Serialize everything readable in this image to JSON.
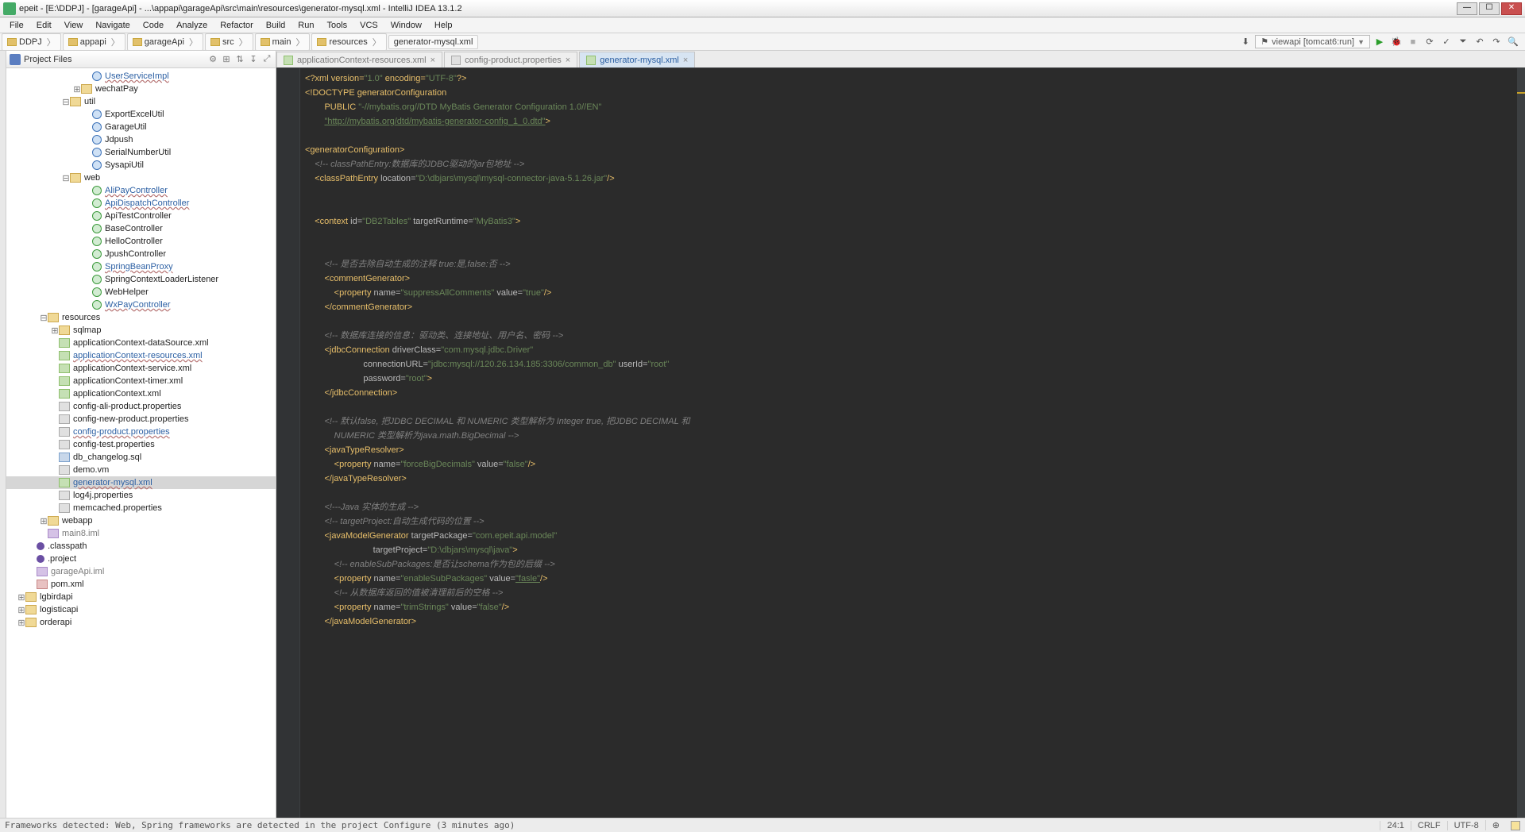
{
  "window": {
    "title": "epeit - [E:\\DDPJ] - [garageApi] - ...\\appapi\\garageApi\\src\\main\\resources\\generator-mysql.xml - IntelliJ IDEA 13.1.2",
    "min": "—",
    "max": "☐",
    "close": "✕"
  },
  "menu": {
    "items": [
      "File",
      "Edit",
      "View",
      "Navigate",
      "Code",
      "Analyze",
      "Refactor",
      "Build",
      "Run",
      "Tools",
      "VCS",
      "Window",
      "Help"
    ]
  },
  "breadcrumb": {
    "items": [
      "DDPJ",
      "appapi",
      "garageApi",
      "src",
      "main",
      "resources",
      "generator-mysql.xml"
    ]
  },
  "run_config": "viewapi [tomcat6:run]",
  "proj_header": "Project Files",
  "proj_tools": [
    "⚙",
    "⊞",
    "⇅",
    "↧",
    "⤢"
  ],
  "tree": [
    {
      "d": 7,
      "t": "C",
      "lbl": "UserServiceImpl",
      "cls": "linkish",
      "icon": "cls"
    },
    {
      "d": 6,
      "t": "+",
      "lbl": "wechatPay",
      "icon": "pkg"
    },
    {
      "d": 5,
      "t": "-",
      "lbl": "util",
      "icon": "pkg"
    },
    {
      "d": 7,
      "t": "C",
      "lbl": "ExportExcelUtil",
      "icon": "cls"
    },
    {
      "d": 7,
      "t": "C",
      "lbl": "GarageUtil",
      "icon": "cls"
    },
    {
      "d": 7,
      "t": "C",
      "lbl": "Jdpush",
      "icon": "cls"
    },
    {
      "d": 7,
      "t": "C",
      "lbl": "SerialNumberUtil",
      "icon": "cls"
    },
    {
      "d": 7,
      "t": "C",
      "lbl": "SysapiUtil",
      "icon": "cls"
    },
    {
      "d": 5,
      "t": "-",
      "lbl": "web",
      "icon": "pkg"
    },
    {
      "d": 7,
      "t": "C",
      "lbl": "AliPayController",
      "cls": "linkish",
      "icon": "cls green"
    },
    {
      "d": 7,
      "t": "C",
      "lbl": "ApiDispatchController",
      "cls": "linkish",
      "icon": "cls green"
    },
    {
      "d": 7,
      "t": "C",
      "lbl": "ApiTestController",
      "icon": "cls green"
    },
    {
      "d": 7,
      "t": "C",
      "lbl": "BaseController",
      "icon": "cls green"
    },
    {
      "d": 7,
      "t": "C",
      "lbl": "HelloController",
      "icon": "cls green"
    },
    {
      "d": 7,
      "t": "C",
      "lbl": "JpushController",
      "icon": "cls green"
    },
    {
      "d": 7,
      "t": "C",
      "lbl": "SpringBeanProxy",
      "cls": "linkish",
      "icon": "cls green"
    },
    {
      "d": 7,
      "t": "C",
      "lbl": "SpringContextLoaderListener",
      "icon": "cls green"
    },
    {
      "d": 7,
      "t": "C",
      "lbl": "WebHelper",
      "icon": "cls green"
    },
    {
      "d": 7,
      "t": "C",
      "lbl": "WxPayController",
      "cls": "linkish",
      "icon": "cls green"
    },
    {
      "d": 3,
      "t": "-",
      "lbl": "resources",
      "icon": "folder"
    },
    {
      "d": 4,
      "t": "+",
      "lbl": "sqlmap",
      "icon": "folder"
    },
    {
      "d": 4,
      "t": "",
      "lbl": "applicationContext-dataSource.xml",
      "icon": "xml"
    },
    {
      "d": 4,
      "t": "",
      "lbl": "applicationContext-resources.xml",
      "cls": "linkish",
      "icon": "xml"
    },
    {
      "d": 4,
      "t": "",
      "lbl": "applicationContext-service.xml",
      "icon": "xml"
    },
    {
      "d": 4,
      "t": "",
      "lbl": "applicationContext-timer.xml",
      "icon": "xml"
    },
    {
      "d": 4,
      "t": "",
      "lbl": "applicationContext.xml",
      "icon": "xml"
    },
    {
      "d": 4,
      "t": "",
      "lbl": "config-ali-product.properties",
      "icon": "prop"
    },
    {
      "d": 4,
      "t": "",
      "lbl": "config-new-product.properties",
      "icon": "prop"
    },
    {
      "d": 4,
      "t": "",
      "lbl": "config-product.properties",
      "cls": "linkish",
      "icon": "prop"
    },
    {
      "d": 4,
      "t": "",
      "lbl": "config-test.properties",
      "icon": "prop"
    },
    {
      "d": 4,
      "t": "",
      "lbl": "db_changelog.sql",
      "icon": "sql"
    },
    {
      "d": 4,
      "t": "",
      "lbl": "demo.vm",
      "icon": "prop"
    },
    {
      "d": 4,
      "t": "",
      "lbl": "generator-mysql.xml",
      "cls": "linkish",
      "sel": true,
      "icon": "xml"
    },
    {
      "d": 4,
      "t": "",
      "lbl": "log4j.properties",
      "icon": "prop"
    },
    {
      "d": 4,
      "t": "",
      "lbl": "memcached.properties",
      "icon": "prop"
    },
    {
      "d": 3,
      "t": "+",
      "lbl": "webapp",
      "icon": "folder"
    },
    {
      "d": 3,
      "t": "",
      "lbl": "main8.iml",
      "cls": "faded",
      "icon": "iml"
    },
    {
      "d": 2,
      "t": "",
      "lbl": ".classpath",
      "icon": "dot"
    },
    {
      "d": 2,
      "t": "",
      "lbl": ".project",
      "icon": "dot"
    },
    {
      "d": 2,
      "t": "",
      "lbl": "garageApi.iml",
      "cls": "faded",
      "icon": "iml"
    },
    {
      "d": 2,
      "t": "",
      "lbl": "pom.xml",
      "icon": "mvn"
    },
    {
      "d": 1,
      "t": "+",
      "lbl": "lgbirdapi",
      "icon": "folder"
    },
    {
      "d": 1,
      "t": "+",
      "lbl": "logisticapi",
      "icon": "folder"
    },
    {
      "d": 1,
      "t": "+",
      "lbl": "orderapi",
      "icon": "folder"
    }
  ],
  "tabs": [
    {
      "label": "applicationContext-resources.xml",
      "type": "xml",
      "active": false
    },
    {
      "label": "config-product.properties",
      "type": "prop",
      "active": false
    },
    {
      "label": "generator-mysql.xml",
      "type": "xml",
      "active": true
    }
  ],
  "code": {
    "l01a": "<?xml version=",
    "l01b": "\"1.0\"",
    "l01c": " encoding=",
    "l01d": "\"UTF-8\"",
    "l01e": "?>",
    "l02": "<!DOCTYPE generatorConfiguration",
    "l03a": "        PUBLIC ",
    "l03b": "\"-//mybatis.org//DTD MyBatis Generator Configuration 1.0//EN\"",
    "l04a": "        ",
    "l04b": "\"http://mybatis.org/dtd/mybatis-generator-config_1_0.dtd\"",
    "l04c": ">",
    "l06a": "<generatorConfiguration>",
    "l07": "    <!-- classPathEntry:数据库的JDBC驱动的jar包地址 -->",
    "l08a": "    <classPathEntry ",
    "l08b": "location=",
    "l08c": "\"D:\\dbjars\\mysql\\mysql-connector-java-5.1.26.jar\"",
    "l08d": "/>",
    "l11a": "    <context ",
    "l11b": "id=",
    "l11c": "\"DB2Tables\"",
    "l11d": " targetRuntime=",
    "l11e": "\"MyBatis3\"",
    "l11f": ">",
    "l14": "        <!-- 是否去除自动生成的注释 true:是,false:否 -->",
    "l15": "        <commentGenerator>",
    "l16a": "            <property ",
    "l16b": "name=",
    "l16c": "\"suppressAllComments\"",
    "l16d": " value=",
    "l16e": "\"true\"",
    "l16f": "/>",
    "l17": "        </commentGenerator>",
    "l19": "        <!-- 数据库连接的信息：驱动类、连接地址、用户名、密码 -->",
    "l20a": "        <jdbcConnection ",
    "l20b": "driverClass=",
    "l20c": "\"com.mysql.jdbc.Driver\"",
    "l21a": "                        connectionURL=",
    "l21b": "\"jdbc:mysql://120.26.134.185:3306/common_db\"",
    "l21c": " userId=",
    "l21d": "\"root\"",
    "l22a": "                        password=",
    "l22b": "\"root\"",
    "l22c": ">",
    "l23": "        </jdbcConnection>",
    "l25": "        <!-- 默认false, 把JDBC DECIMAL 和 NUMERIC 类型解析为 Integer true, 把JDBC DECIMAL 和",
    "l26": "            NUMERIC 类型解析为java.math.BigDecimal -->",
    "l27": "        <javaTypeResolver>",
    "l28a": "            <property ",
    "l28b": "name=",
    "l28c": "\"forceBigDecimals\"",
    "l28d": " value=",
    "l28e": "\"false\"",
    "l28f": "/>",
    "l29": "        </javaTypeResolver>",
    "l31": "        <!---Java 实体的生成 -->",
    "l32": "        <!-- targetProject:自动生成代码的位置 -->",
    "l33a": "        <javaModelGenerator ",
    "l33b": "targetPackage=",
    "l33c": "\"com.epeit.api.model\"",
    "l34a": "                            targetProject=",
    "l34b": "\"D:\\dbjars\\mysql\\java\"",
    "l34c": ">",
    "l35": "            <!-- enableSubPackages:是否让schema作为包的后缀 -->",
    "l36a": "            <property ",
    "l36b": "name=",
    "l36c": "\"enableSubPackages\"",
    "l36d": " value=",
    "l36e": "\"fasle\"",
    "l36f": "/>",
    "l37": "            <!-- 从数据库返回的值被清理前后的空格 -->",
    "l38a": "            <property ",
    "l38b": "name=",
    "l38c": "\"trimStrings\"",
    "l38d": " value=",
    "l38e": "\"false\"",
    "l38f": "/>",
    "l39": "        </javaModelGenerator>"
  },
  "status": {
    "msg": "Frameworks detected: Web, Spring frameworks are detected in the project Configure (3 minutes ago)",
    "pos": "24:1",
    "eol": "CRLF",
    "enc": "UTF-8",
    "ins": "⊕"
  }
}
